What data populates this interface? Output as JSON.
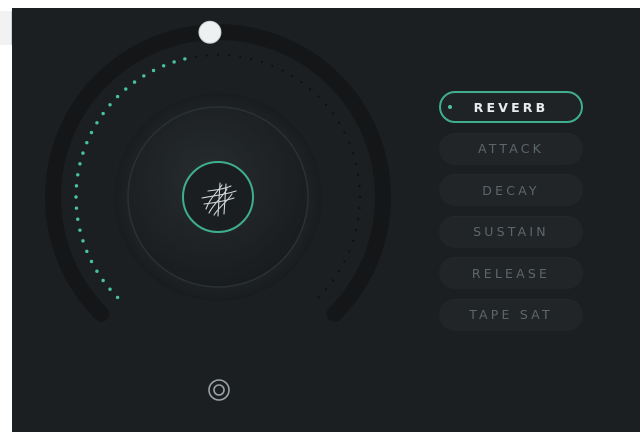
{
  "parameters": [
    {
      "label": "REVERB",
      "active": true
    },
    {
      "label": "ATTACK",
      "active": false
    },
    {
      "label": "DECAY",
      "active": false
    },
    {
      "label": "SUSTAIN",
      "active": false
    },
    {
      "label": "RELEASE",
      "active": false
    },
    {
      "label": "TAPE SAT",
      "active": false
    }
  ],
  "knob": {
    "value_fraction": 0.46,
    "center_icon": "waveform-scribble-icon"
  },
  "power": {
    "icon": "power-target-icon"
  },
  "colors": {
    "accent": "#48c49b",
    "panel": "#1c1f21",
    "track": "#111315",
    "inactive_text": "#5d6669",
    "active_text": "#e9ecec"
  }
}
